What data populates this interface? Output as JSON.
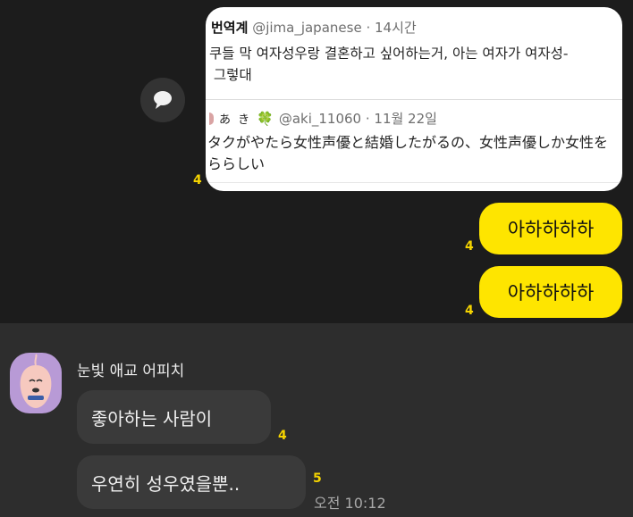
{
  "shared_card": {
    "tweet1": {
      "name": "번역계",
      "handle_time": "@jima_japanese · 14시간",
      "line1": "쿠들 막 여자성우랑 결혼하고 싶어하는거, 아는 여자가 여자성-",
      "line2": " 그렇대"
    },
    "tweet2": {
      "name_hira": "あ き",
      "clover": "🍀",
      "handle_time": "@aki_11060 · 11월 22일",
      "line1": "タクがやたら女性声優と結婚したがるの、女性声優しか女性を",
      "line2": "ららしい"
    },
    "unread": "4"
  },
  "my_messages": [
    {
      "text": "아하하하하",
      "unread": "4"
    },
    {
      "text": "아하하하하",
      "unread": "4"
    }
  ],
  "other": {
    "sender_name": "눈빛 애교 어피치",
    "messages": [
      {
        "text": "좋아하는 사람이",
        "unread": "4"
      },
      {
        "text": "우연히 성우였을뿐..",
        "unread": "5"
      }
    ],
    "time": "오전 10:12"
  },
  "colors": {
    "my_bubble": "#fee500",
    "other_bubble": "#3a3a3a",
    "unread": "#f5d400",
    "avatar_bg": "#b89ad6"
  },
  "icons": {
    "share": "speech-bubble-icon",
    "avatar": "apeach-character-icon"
  }
}
